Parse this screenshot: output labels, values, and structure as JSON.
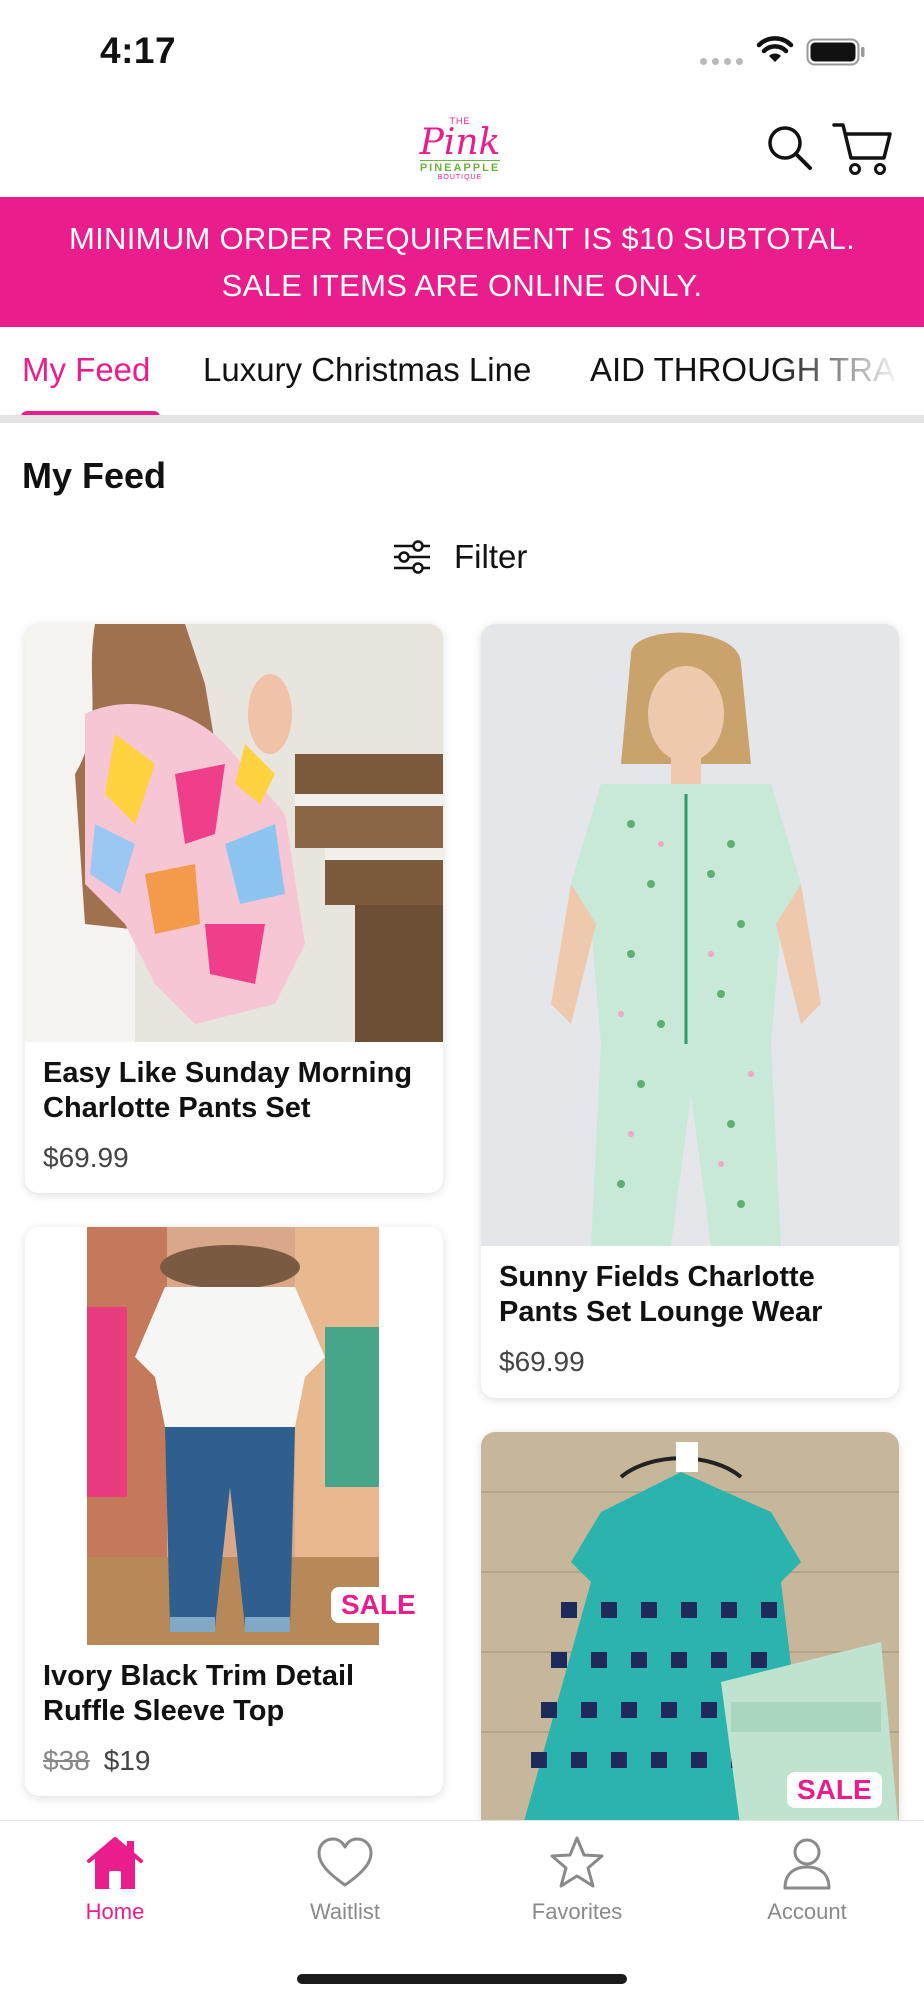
{
  "status_bar": {
    "time": "4:17"
  },
  "header": {
    "logo": {
      "the": "THE",
      "pink": "Pink",
      "pineapple": "PINEAPPLE",
      "boutique": "BOUTIQUE"
    },
    "icons": [
      "search-icon",
      "cart-icon"
    ]
  },
  "banner": {
    "line1": "MINIMUM ORDER REQUIREMENT IS $10 SUBTOTAL.",
    "line2": "SALE ITEMS ARE ONLINE ONLY.",
    "color": "#e91e8c"
  },
  "tabs": [
    {
      "label": "My Feed",
      "active": true
    },
    {
      "label": "Luxury Christmas Line",
      "active": false
    },
    {
      "label": "AID THROUGH TRA",
      "active": false
    }
  ],
  "feed": {
    "title": "My Feed",
    "filter_label": "Filter",
    "products": [
      {
        "title": "Easy Like Sunday Morning Charlotte Pants Set",
        "price": "$69.99"
      },
      {
        "title": "Sunny Fields Charlotte Pants Set Lounge Wear",
        "price": "$69.99"
      },
      {
        "title": "Ivory Black Trim Detail Ruffle Sleeve Top",
        "original_price": "$38",
        "price": "$19",
        "badge": "SALE"
      },
      {
        "badge": "SALE"
      }
    ]
  },
  "tabbar": {
    "items": [
      {
        "label": "Home",
        "icon": "home-icon",
        "active": true
      },
      {
        "label": "Waitlist",
        "icon": "heart-icon",
        "active": false
      },
      {
        "label": "Favorites",
        "icon": "star-icon",
        "active": false
      },
      {
        "label": "Account",
        "icon": "person-icon",
        "active": false
      }
    ]
  },
  "colors": {
    "accent": "#e91e8c",
    "inactive": "#8a8a8a"
  }
}
